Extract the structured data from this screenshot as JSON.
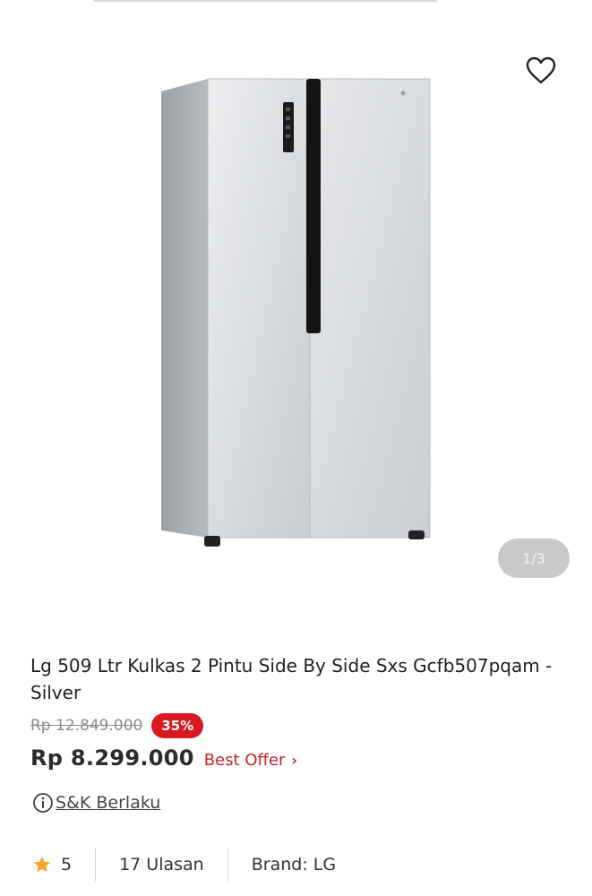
{
  "gallery": {
    "pager": "1/3",
    "wishlist_icon": "heart-outline-icon",
    "product_image": "refrigerator-image"
  },
  "product": {
    "title": "Lg 509 Ltr Kulkas 2 Pintu Side By Side Sxs Gcfb507pqam - Silver",
    "old_price": "Rp 12.849.000",
    "discount": "35%",
    "price": "Rp 8.299.000",
    "best_offer": "Best Offer",
    "terms": "S&K Berlaku",
    "rating": "5",
    "reviews": "17 Ulasan",
    "brand_label": "Brand:",
    "brand_value": "LG"
  },
  "colors": {
    "discount_bg": "#d71920",
    "best_offer": "#d21f2a",
    "star": "#f2a623"
  }
}
